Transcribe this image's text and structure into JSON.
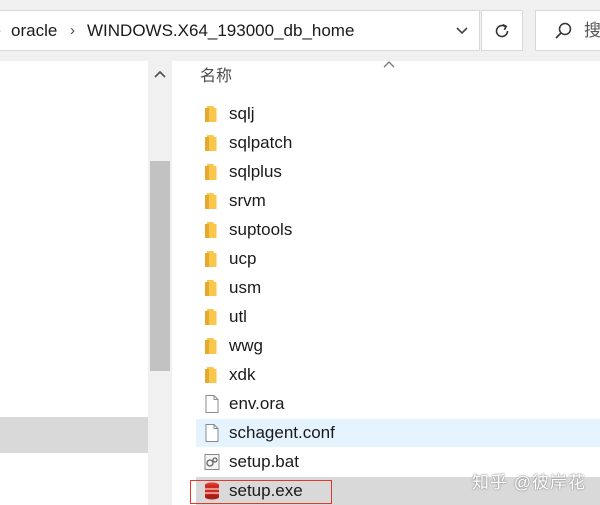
{
  "address_bar": {
    "segments": [
      "oracle",
      "WINDOWS.X64_193000_db_home"
    ]
  },
  "search": {
    "placeholder": "搜"
  },
  "file_list": {
    "column_header": "名称",
    "items": [
      {
        "name": "sqlj",
        "type": "folder"
      },
      {
        "name": "sqlpatch",
        "type": "folder"
      },
      {
        "name": "sqlplus",
        "type": "folder"
      },
      {
        "name": "srvm",
        "type": "folder"
      },
      {
        "name": "suptools",
        "type": "folder"
      },
      {
        "name": "ucp",
        "type": "folder"
      },
      {
        "name": "usm",
        "type": "folder"
      },
      {
        "name": "utl",
        "type": "folder"
      },
      {
        "name": "wwg",
        "type": "folder"
      },
      {
        "name": "xdk",
        "type": "folder"
      },
      {
        "name": "env.ora",
        "type": "file"
      },
      {
        "name": "schagent.conf",
        "type": "file",
        "state": "hover"
      },
      {
        "name": "setup.bat",
        "type": "batch"
      },
      {
        "name": "setup.exe",
        "type": "exe",
        "state": "selected"
      }
    ]
  },
  "watermark": "知乎 @彼岸花",
  "colors": {
    "folder": "#f8c74b",
    "hover": "#e5f3ff",
    "selected": "#d9d9d9",
    "outline": "#e0392b"
  }
}
